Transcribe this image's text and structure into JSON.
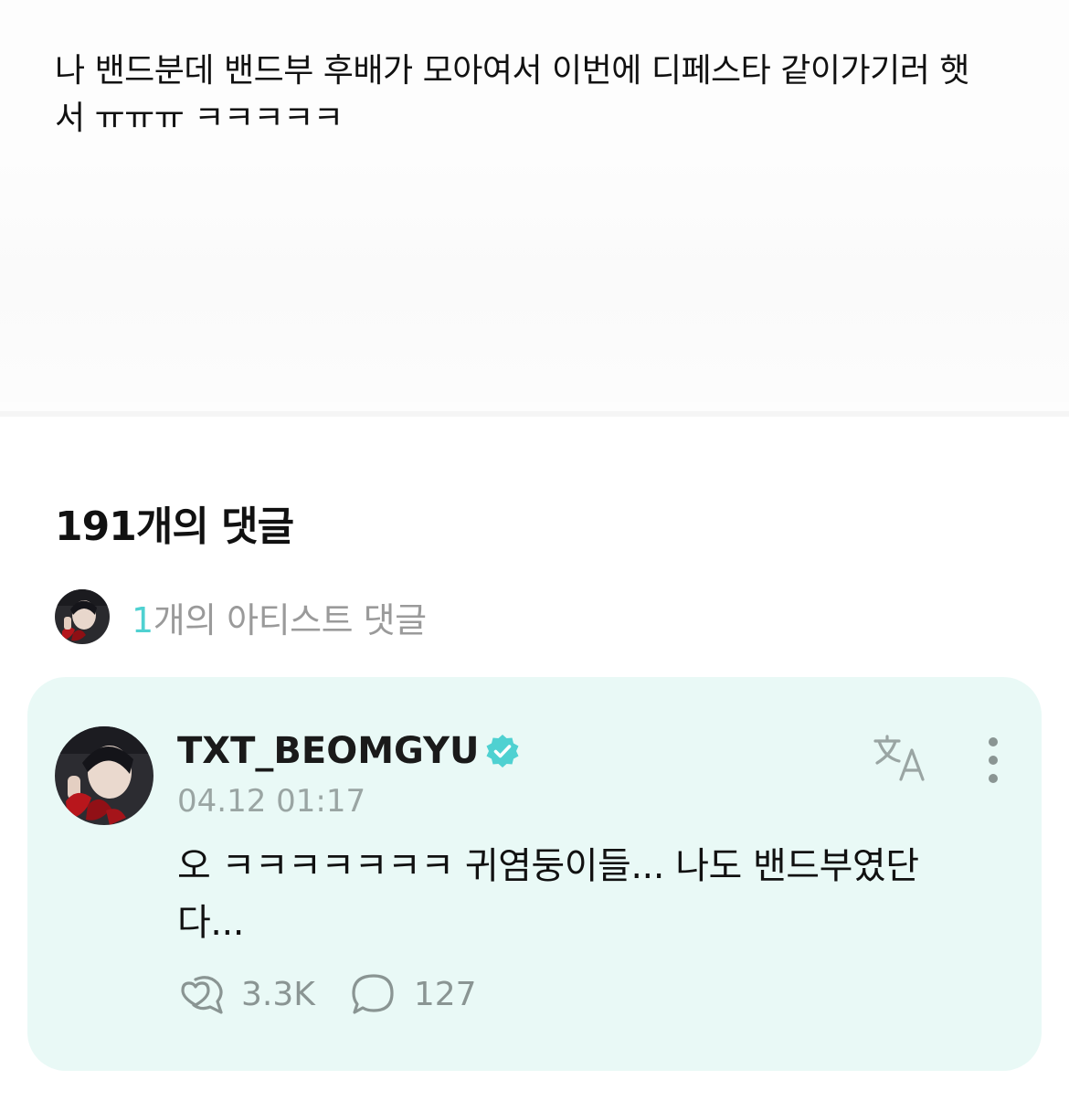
{
  "post": {
    "body_line1": "나 밴드분데 밴드부 후배가 모아여서 이번에 디페스타 같이가기러 햇",
    "body_line2": "서 ㅠㅠㅠ ㅋㅋㅋㅋㅋ"
  },
  "comments": {
    "title": "191개의 댓글",
    "artist_summary": {
      "count": "1",
      "label": "개의 아티스트 댓글"
    }
  },
  "comment": {
    "username": "TXT_BEOMGYU",
    "timestamp": "04.12 01:17",
    "text_line1": "오 ㅋㅋㅋㅋㅋㅋㅋ 귀염둥이들... 나도 밴드부였단",
    "text_line2": "다...",
    "likes": "3.3K",
    "replies": "127"
  },
  "icons": {
    "verified": "verified-badge-icon",
    "translate": "translate-icon",
    "more": "more-vertical-icon",
    "like": "heart-bubble-icon",
    "reply": "speech-bubble-icon"
  },
  "colors": {
    "accent": "#4fd1d1",
    "card_background": "#e9f9f6",
    "muted": "#9aa5a3"
  }
}
